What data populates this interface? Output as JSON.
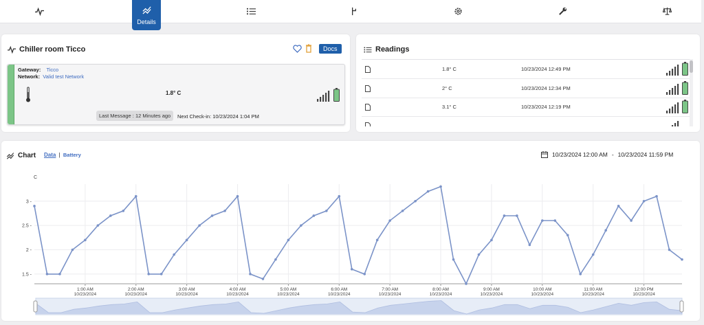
{
  "nav": {
    "items": [
      {
        "icon": "pulse-icon",
        "label": ""
      },
      {
        "icon": "chart-lines-icon",
        "label": "Details"
      },
      {
        "icon": "list-icon",
        "label": ""
      },
      {
        "icon": "branch-icon",
        "label": ""
      },
      {
        "icon": "gear-icon",
        "label": ""
      },
      {
        "icon": "wrench-icon",
        "label": ""
      },
      {
        "icon": "scale-icon",
        "label": ""
      }
    ],
    "active_label": "Details"
  },
  "device": {
    "title": "Chiller room Ticco",
    "docs_label": "Docs",
    "gateway_label": "Gateway:",
    "gateway_value": "Ticco",
    "network_label": "Network:",
    "network_value": "Valid test Network",
    "temperature": "1.8° C",
    "last_message": "Last Message : 12 Minutes ago",
    "next_checkin": "Next Check-in: 10/23/2024   1:04 PM"
  },
  "readings": {
    "title": "Readings",
    "rows": [
      {
        "value": "1.8° C",
        "time": "10/23/2024 12:49 PM"
      },
      {
        "value": "2° C",
        "time": "10/23/2024 12:34 PM"
      },
      {
        "value": "3.1° C",
        "time": "10/23/2024 12:19 PM"
      }
    ]
  },
  "chart_panel": {
    "title": "Chart",
    "tab_data": "Data",
    "tab_separator": "|",
    "tab_battery": "Battery",
    "range_start": "10/23/2024 12:00 AM",
    "range_sep": "-",
    "range_end": "10/23/2024 11:59 PM"
  },
  "chart_data": {
    "type": "line",
    "unit_label": "C",
    "ylim": [
      1.3,
      3.35
    ],
    "y_ticks": [
      "3 -",
      "2.5 -",
      "2 -",
      "1.5 -"
    ],
    "y_tick_values": [
      3,
      2.5,
      2,
      1.5
    ],
    "x_ticks": [
      {
        "time": "1:00 AM",
        "date": "10/23/2024"
      },
      {
        "time": "2:00 AM",
        "date": "10/23/2024"
      },
      {
        "time": "3:00 AM",
        "date": "10/23/2024"
      },
      {
        "time": "4:00 AM",
        "date": "10/23/2024"
      },
      {
        "time": "5:00 AM",
        "date": "10/23/2024"
      },
      {
        "time": "6:00 AM",
        "date": "10/23/2024"
      },
      {
        "time": "7:00 AM",
        "date": "10/23/2024"
      },
      {
        "time": "8:00 AM",
        "date": "10/23/2024"
      },
      {
        "time": "9:00 AM",
        "date": "10/23/2024"
      },
      {
        "time": "10:00 AM",
        "date": "10/23/2024"
      },
      {
        "time": "11:00 AM",
        "date": "10/23/2024"
      },
      {
        "time": "12:00 PM",
        "date": "10/23/2024"
      }
    ],
    "x_tick_hours": [
      1,
      2,
      3,
      4,
      5,
      6,
      7,
      8,
      9,
      10,
      11,
      12
    ],
    "grid": true,
    "series": [
      {
        "hours": [
          0.0,
          0.25,
          0.5,
          0.75,
          1.0,
          1.25,
          1.5,
          1.75,
          2.0,
          2.25,
          2.5,
          2.75,
          3.0,
          3.25,
          3.5,
          3.75,
          4.0,
          4.25,
          4.5,
          4.75,
          5.0,
          5.25,
          5.5,
          5.75,
          6.0,
          6.25,
          6.5,
          6.75,
          7.0,
          7.25,
          7.5,
          7.75,
          8.0,
          8.25,
          8.5,
          8.75,
          9.0,
          9.25,
          9.5,
          9.75,
          10.0,
          10.25,
          10.5,
          10.75,
          11.0,
          11.25,
          11.5,
          11.75,
          12.0,
          12.25,
          12.5,
          12.75
        ],
        "values": [
          2.9,
          1.5,
          1.5,
          2.0,
          2.2,
          2.5,
          2.7,
          2.8,
          3.1,
          1.5,
          1.5,
          1.9,
          2.2,
          2.5,
          2.7,
          2.8,
          3.1,
          1.5,
          1.4,
          1.8,
          2.2,
          2.5,
          2.7,
          2.8,
          3.1,
          1.6,
          1.5,
          2.2,
          2.6,
          2.8,
          3.0,
          3.2,
          3.3,
          1.8,
          1.3,
          1.9,
          2.2,
          2.7,
          2.7,
          2.1,
          2.6,
          2.6,
          2.3,
          1.5,
          1.9,
          2.4,
          2.9,
          2.6,
          3.0,
          3.1,
          2.0,
          1.8
        ],
        "color": "#7b93c8"
      }
    ]
  }
}
